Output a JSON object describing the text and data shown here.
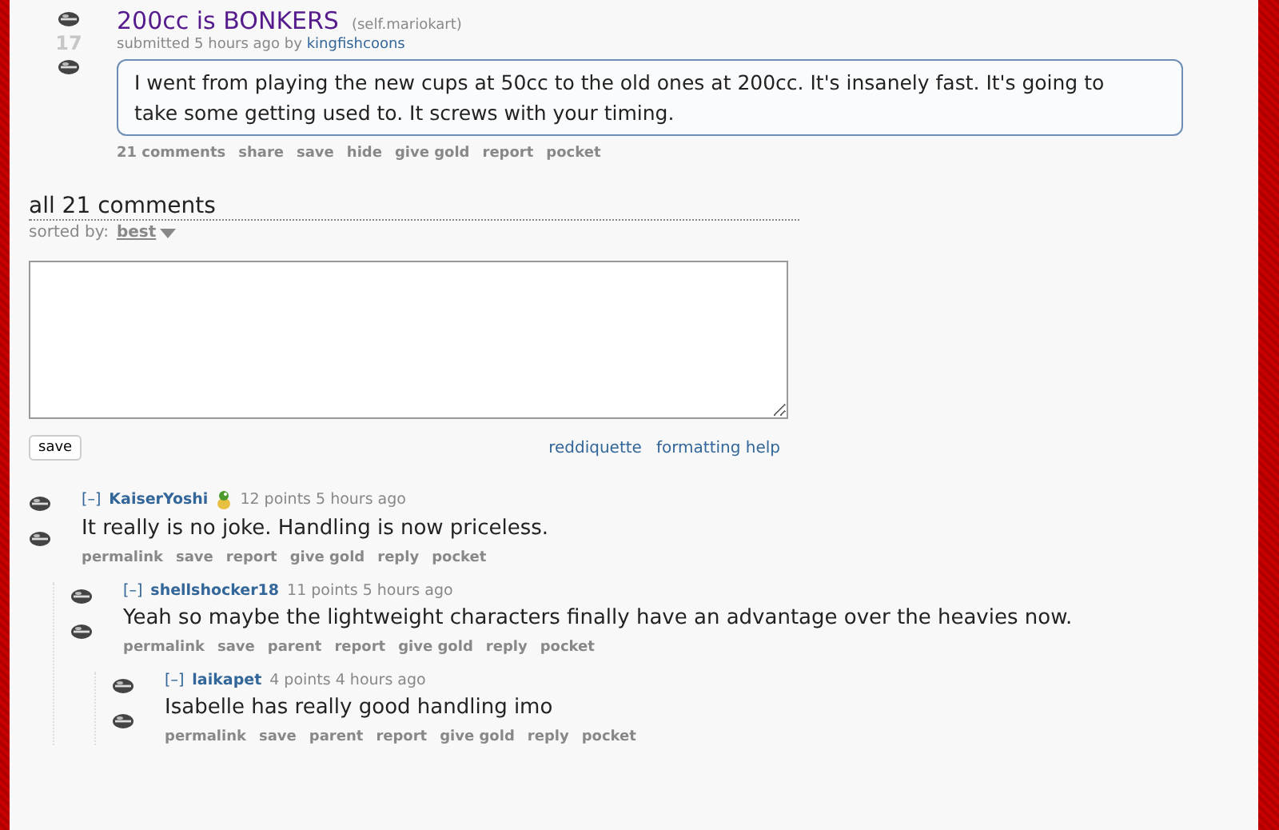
{
  "post": {
    "score": "17",
    "title": "200cc is BONKERS",
    "domain": "(self.mariokart)",
    "tagline_prefix": "submitted 5 hours ago by",
    "author": "kingfishcoons",
    "body": "I went from playing the new cups at 50cc to the old ones at 200cc. It's insanely fast. It's going to take some getting used to. It screws with your timing.",
    "actions": [
      "21 comments",
      "share",
      "save",
      "hide",
      "give gold",
      "report",
      "pocket"
    ]
  },
  "comments_header": {
    "title": "all 21 comments",
    "sort_label": "sorted by:",
    "sort_value": "best"
  },
  "comment_form": {
    "save": "save",
    "links": [
      "reddiquette",
      "formatting help"
    ]
  },
  "comments": [
    {
      "toggle": "[–]",
      "author": "KaiserYoshi",
      "has_flair": true,
      "meta": "12 points 5 hours ago",
      "body": "It really is no joke. Handling is now priceless.",
      "actions": [
        "permalink",
        "save",
        "report",
        "give gold",
        "reply",
        "pocket"
      ],
      "children": [
        {
          "toggle": "[–]",
          "author": "shellshocker18",
          "has_flair": false,
          "meta": "11 points 5 hours ago",
          "body": "Yeah so maybe the lightweight characters finally have an advantage over the heavies now.",
          "actions": [
            "permalink",
            "save",
            "parent",
            "report",
            "give gold",
            "reply",
            "pocket"
          ],
          "children": [
            {
              "toggle": "[–]",
              "author": "laikapet",
              "has_flair": false,
              "meta": "4 points 4 hours ago",
              "body": "Isabelle has really good handling imo",
              "actions": [
                "permalink",
                "save",
                "parent",
                "report",
                "give gold",
                "reply",
                "pocket"
              ]
            }
          ]
        }
      ]
    }
  ]
}
